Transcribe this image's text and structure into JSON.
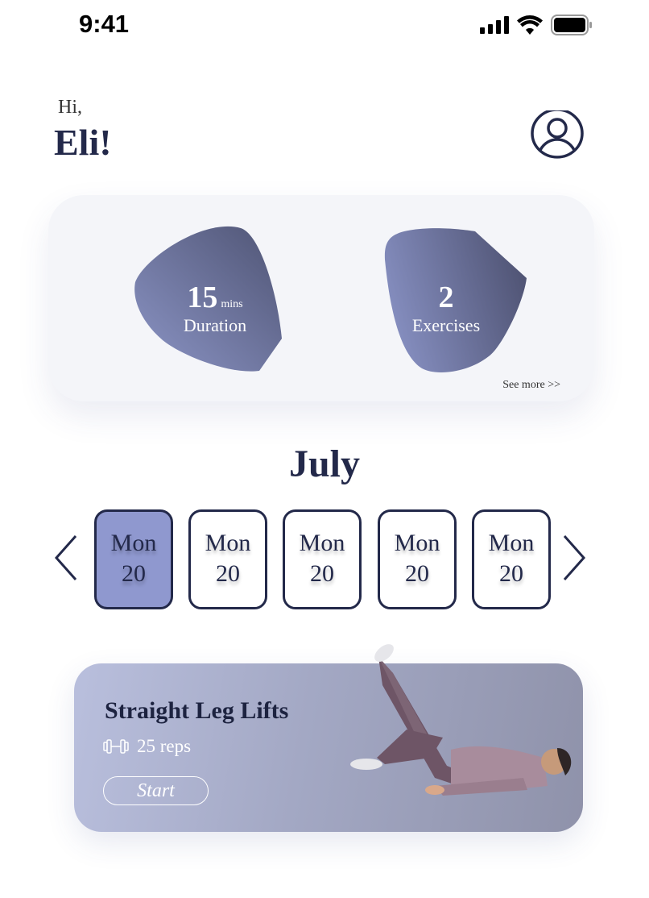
{
  "status_bar": {
    "time": "9:41"
  },
  "greeting": {
    "hi": "Hi,",
    "name": "Eli!"
  },
  "stats": {
    "duration_value": "15",
    "duration_unit": "mins",
    "duration_label": "Duration",
    "exercises_value": "2",
    "exercises_label": "Exercises",
    "see_more": "See more >>"
  },
  "calendar": {
    "month": "July",
    "days": [
      {
        "weekday": "Mon",
        "date": "20",
        "selected": true
      },
      {
        "weekday": "Mon",
        "date": "20",
        "selected": false
      },
      {
        "weekday": "Mon",
        "date": "20",
        "selected": false
      },
      {
        "weekday": "Mon",
        "date": "20",
        "selected": false
      },
      {
        "weekday": "Mon",
        "date": "20",
        "selected": false
      }
    ]
  },
  "exercise": {
    "title": "Straight Leg Lifts",
    "reps": "25 reps",
    "start_label": "Start"
  },
  "colors": {
    "primary": "#23294a",
    "accent": "#8f98cf",
    "card_bg": "#f4f5f9"
  }
}
